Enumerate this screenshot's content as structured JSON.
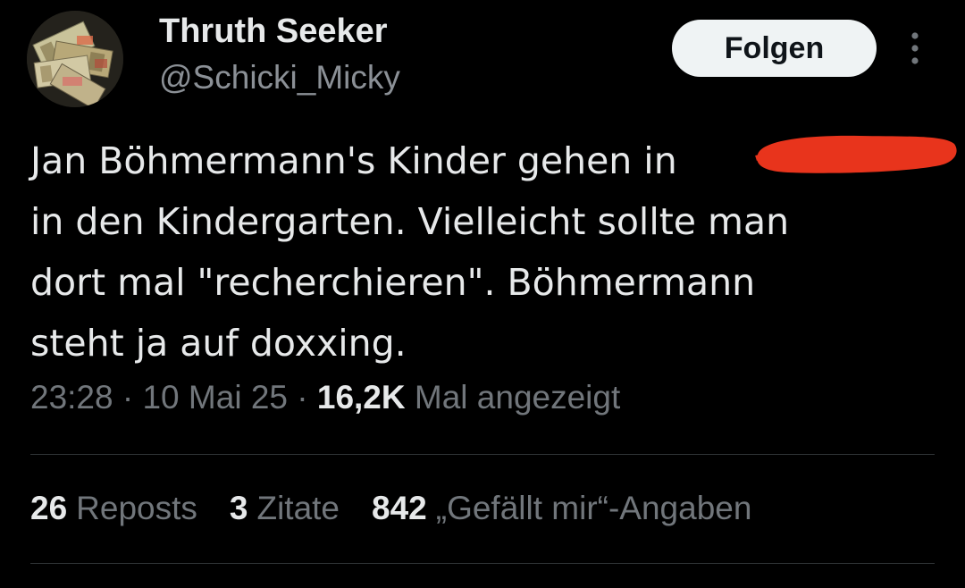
{
  "author": {
    "display_name": "Thruth Seeker",
    "handle": "@Schicki_Micky",
    "avatar_icon": "money-banknotes-avatar"
  },
  "actions": {
    "follow_label": "Folgen",
    "more_icon": "more-vertical-icon"
  },
  "tweet": {
    "lines": [
      "Jan Böhmermann's Kinder gehen in",
      "in den Kindergarten. Vielleicht sollte man",
      "dort mal \"recherchieren\". Böhmermann",
      "steht ja auf doxxing."
    ],
    "redaction_color": "#e8341c"
  },
  "meta": {
    "time": "23:28",
    "separator": " · ",
    "date": "10 Mai 25",
    "views_count": "16,2K",
    "views_label": "Mal angezeigt"
  },
  "stats": {
    "reposts_count": "26",
    "reposts_label": "Reposts",
    "quotes_count": "3",
    "quotes_label": "Zitate",
    "likes_count": "842",
    "likes_label": "„Gefällt mir“-Angaben"
  },
  "colors": {
    "background": "#000000",
    "text_primary": "#e7e9ea",
    "text_secondary": "#71767b",
    "button_bg": "#eff3f4"
  }
}
